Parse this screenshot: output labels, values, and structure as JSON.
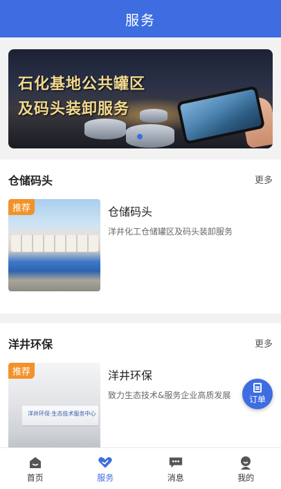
{
  "header": {
    "title": "服务"
  },
  "banner": {
    "line1": "石化基地公共罐区",
    "line2": "及码头装卸服务",
    "active_dot": 1,
    "dot_count": 1
  },
  "sections": [
    {
      "title": "仓储码头",
      "more": "更多",
      "item": {
        "badge": "推荐",
        "title": "仓储码头",
        "desc": "洋井化工仓储罐区及码头装卸服务"
      }
    },
    {
      "title": "洋井环保",
      "more": "更多",
      "item": {
        "badge": "推荐",
        "title": "洋井环保",
        "desc": "致力生态技术&服务企业高质发展",
        "wall_text": "洋井环保·生态技术服务中心"
      }
    }
  ],
  "fab": {
    "label": "订单",
    "icon": "order-icon"
  },
  "tabbar": {
    "items": [
      {
        "label": "首页",
        "icon": "home-icon",
        "active": false
      },
      {
        "label": "服务",
        "icon": "service-icon",
        "active": true
      },
      {
        "label": "消息",
        "icon": "message-icon",
        "active": false
      },
      {
        "label": "我的",
        "icon": "profile-icon",
        "active": false
      }
    ]
  },
  "colors": {
    "primary": "#3d6de0",
    "badge": "#f1922a",
    "icon_gray": "#555555"
  }
}
